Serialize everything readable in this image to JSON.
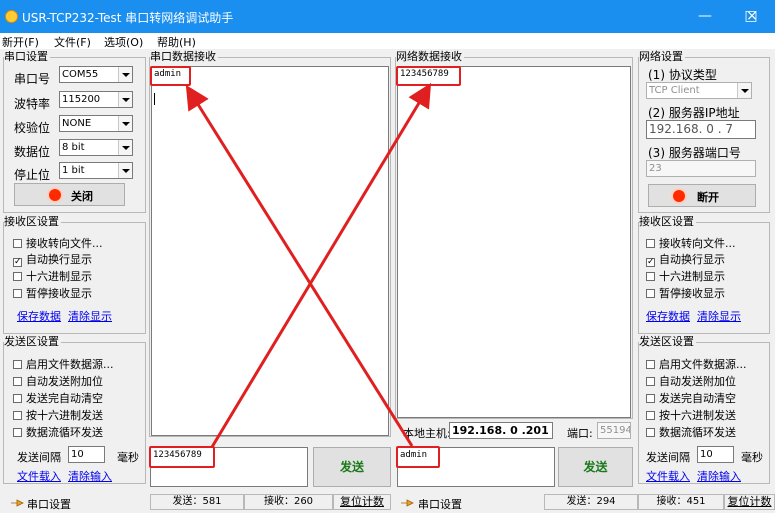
{
  "window": {
    "title": "USR-TCP232-Test 串口转网络调试助手",
    "minimize": "—",
    "maximize": "□",
    "close": "×"
  },
  "menu": [
    "新开(F)",
    "文件(F)",
    "选项(O)",
    "帮助(H)"
  ],
  "serial_settings": {
    "group_title": "串口设置",
    "port_label": "串口号",
    "port_value": "COM55",
    "baud_label": "波特率",
    "baud_value": "115200",
    "parity_label": "校验位",
    "parity_value": "NONE",
    "databits_label": "数据位",
    "databits_value": "8 bit",
    "stopbits_label": "停止位",
    "stopbits_value": "1 bit",
    "toggle_label": "关闭"
  },
  "serial_receive_settings": {
    "group_title": "接收区设置",
    "options": [
      {
        "label": "接收转向文件...",
        "checked": false
      },
      {
        "label": "自动换行显示",
        "checked": true
      },
      {
        "label": "十六进制显示",
        "checked": false
      },
      {
        "label": "暂停接收显示",
        "checked": false
      }
    ],
    "save_link": "保存数据",
    "clear_link": "清除显示"
  },
  "serial_send_settings": {
    "group_title": "发送区设置",
    "options": [
      {
        "label": "启用文件数据源...",
        "checked": false
      },
      {
        "label": "自动发送附加位",
        "checked": false
      },
      {
        "label": "发送完自动清空",
        "checked": false
      },
      {
        "label": "按十六进制发送",
        "checked": false
      },
      {
        "label": "数据流循环发送",
        "checked": false
      }
    ],
    "interval_label": "发送间隔",
    "interval_value": "10",
    "interval_unit": "毫秒",
    "load_link": "文件载入",
    "clear_link": "清除输入"
  },
  "serial_receive": {
    "title": "串口数据接收",
    "content": "admin"
  },
  "net_receive": {
    "title": "网络数据接收",
    "content": "123456789"
  },
  "serial_send": {
    "content": "123456789",
    "button": "发送"
  },
  "net_send": {
    "content": "admin",
    "button": "发送"
  },
  "local_host": {
    "label": "本地主机:",
    "ip": "192.168. 0 .201",
    "port_label": "端口:",
    "port_value": "55194"
  },
  "net_settings": {
    "group_title": "网络设置",
    "protocol_label": "(1) 协议类型",
    "protocol_value": "TCP Client",
    "server_ip_label": "(2) 服务器IP地址",
    "server_ip_value": "192.168. 0 . 7",
    "server_port_label": "(3) 服务器端口号",
    "server_port_value": "23",
    "toggle_label": "断开"
  },
  "net_receive_settings": {
    "group_title": "接收区设置",
    "options": [
      {
        "label": "接收转向文件...",
        "checked": false
      },
      {
        "label": "自动换行显示",
        "checked": true
      },
      {
        "label": "十六进制显示",
        "checked": false
      },
      {
        "label": "暂停接收显示",
        "checked": false
      }
    ],
    "save_link": "保存数据",
    "clear_link": "清除显示"
  },
  "net_send_settings": {
    "group_title": "发送区设置",
    "options": [
      {
        "label": "启用文件数据源...",
        "checked": false
      },
      {
        "label": "自动发送附加位",
        "checked": false
      },
      {
        "label": "发送完自动清空",
        "checked": false
      },
      {
        "label": "按十六进制发送",
        "checked": false
      },
      {
        "label": "数据流循环发送",
        "checked": false
      }
    ],
    "interval_label": "发送间隔",
    "interval_value": "10",
    "interval_unit": "毫秒",
    "load_link": "文件载入",
    "clear_link": "清除输入"
  },
  "status_left": {
    "label": "串口设置",
    "sent": "发送：581",
    "received": "接收：260",
    "reset": "复位计数"
  },
  "status_right": {
    "label": "串口设置",
    "sent": "发送：294",
    "received": "接收：451",
    "reset": "复位计数"
  },
  "colors": {
    "titlebar": "#1a8ff0",
    "highlight": "#e02020",
    "link": "#0000ee"
  }
}
